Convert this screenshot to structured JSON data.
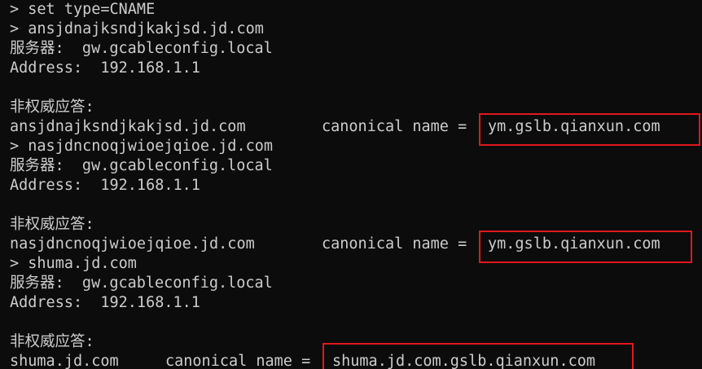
{
  "terminal": {
    "lines": [
      {
        "id": "l0",
        "text": "> set type=CNAME"
      },
      {
        "id": "l1",
        "text": "> ansjdnajksndjkakjsd.jd.com"
      },
      {
        "id": "l2",
        "text": "服务器:  gw.gcableconfig.local"
      },
      {
        "id": "l3",
        "text": "Address:  192.168.1.1"
      },
      {
        "id": "l4",
        "text": ""
      },
      {
        "id": "l5",
        "text": "非权威应答:"
      },
      {
        "id": "l6",
        "host": "ansjdnajksndjkakjsd.jd.com",
        "label": "canonical name =",
        "value": "ym.gslb.qianxun.com"
      },
      {
        "id": "l7",
        "text": "> nasjdncnoqjwioejqioe.jd.com"
      },
      {
        "id": "l8",
        "text": "服务器:  gw.gcableconfig.local"
      },
      {
        "id": "l9",
        "text": "Address:  192.168.1.1"
      },
      {
        "id": "l10",
        "text": ""
      },
      {
        "id": "l11",
        "text": "非权威应答:"
      },
      {
        "id": "l12",
        "host": "nasjdncnoqjwioejqioe.jd.com",
        "label": "canonical name =",
        "value": "ym.gslb.qianxun.com"
      },
      {
        "id": "l13",
        "text": "> shuma.jd.com"
      },
      {
        "id": "l14",
        "text": "服务器:  gw.gcableconfig.local"
      },
      {
        "id": "l15",
        "text": "Address:  192.168.1.1"
      },
      {
        "id": "l16",
        "text": ""
      },
      {
        "id": "l17",
        "text": "非权威应答:"
      },
      {
        "id": "l18",
        "host": "shuma.jd.com",
        "label": "canonical name =",
        "value": "shuma.jd.com.gslb.qianxun.com"
      }
    ]
  },
  "colors": {
    "background": "#0c0c0c",
    "text": "#cccccc",
    "highlight_border": "#e0181e"
  }
}
